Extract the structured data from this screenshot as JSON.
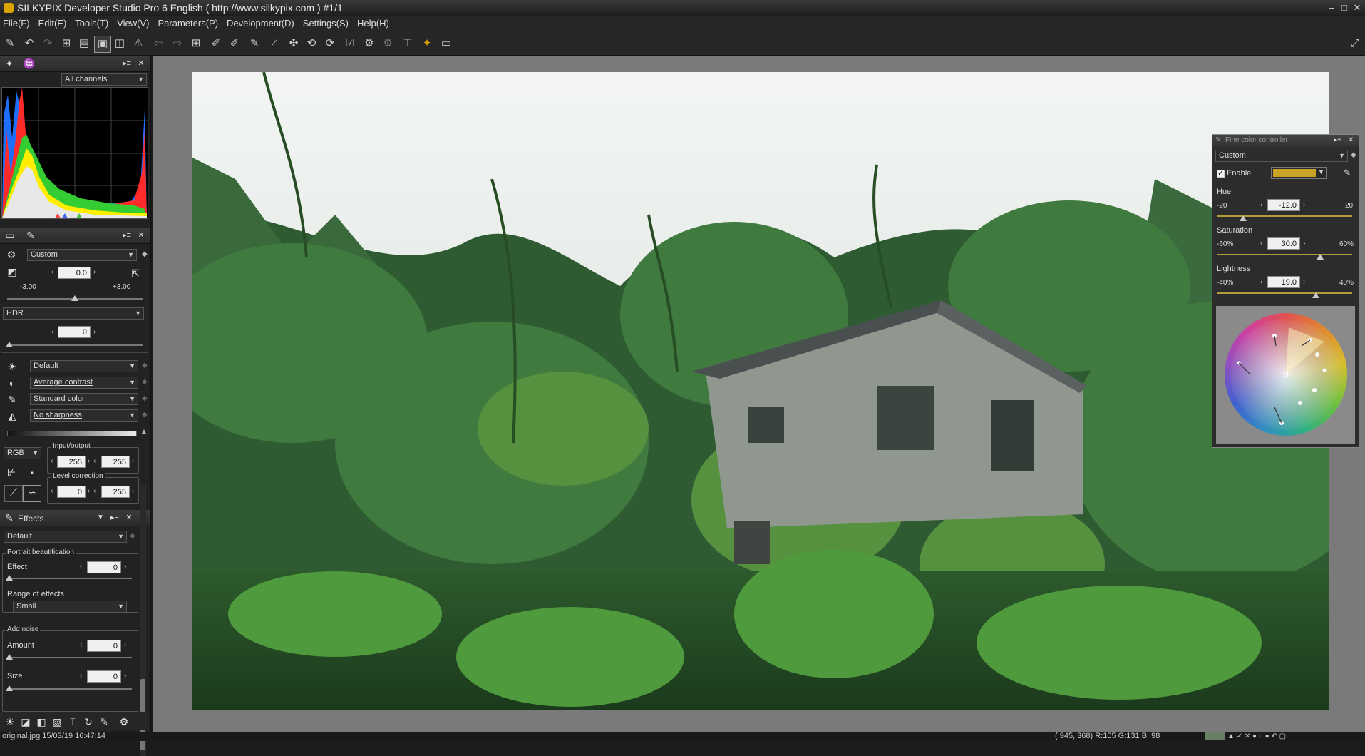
{
  "window": {
    "title": "SILKYPIX Developer Studio Pro 6 English ( http://www.silkypix.com )   #1/1",
    "minimize": "–",
    "maximize": "□",
    "close": "✕"
  },
  "menu": [
    "File(F)",
    "Edit(E)",
    "Tools(T)",
    "View(V)",
    "Parameters(P)",
    "Development(D)",
    "Settings(S)",
    "Help(H)"
  ],
  "histogram": {
    "channel": "All channels"
  },
  "exposure": {
    "preset": "Custom",
    "value": "0.0",
    "min": "-3.00",
    "max": "+3.00"
  },
  "hdr": {
    "label": "HDR",
    "value": "0"
  },
  "presets": {
    "white_balance": "Default",
    "contrast": "Average contrast",
    "color": "Standard color",
    "sharpness": "No sharpness"
  },
  "tone": {
    "channel": "RGB",
    "input_output_label": "Input/output",
    "input": "255",
    "output": "255",
    "level_label": "Level correction",
    "level_low": "0",
    "level_high": "255"
  },
  "effects": {
    "title": "Effects",
    "preset": "Default",
    "portrait_group": "Portrait beautification",
    "effect_label": "Effect",
    "effect_value": "0",
    "range_label": "Range of effects",
    "range_value": "Small",
    "noise_group": "Add noise",
    "amount_label": "Amount",
    "amount_value": "0",
    "size_label": "Size",
    "size_value": "0"
  },
  "fine_color": {
    "title": "Fine color controller",
    "preset": "Custom",
    "enable_label": "Enable",
    "swatch_color": "#c9a227",
    "hue_label": "Hue",
    "hue_value": "-12.0",
    "hue_min": "-20",
    "hue_max": "20",
    "sat_label": "Saturation",
    "sat_value": "30.0",
    "sat_min": "-60%",
    "sat_max": "60%",
    "light_label": "Lightness",
    "light_value": "19.0",
    "light_min": "-40%",
    "light_max": "40%"
  },
  "status": {
    "file": "original.jpg 15/03/19 16:47:14",
    "pixel": "( 945, 368) R:105 G:131 B: 98"
  }
}
